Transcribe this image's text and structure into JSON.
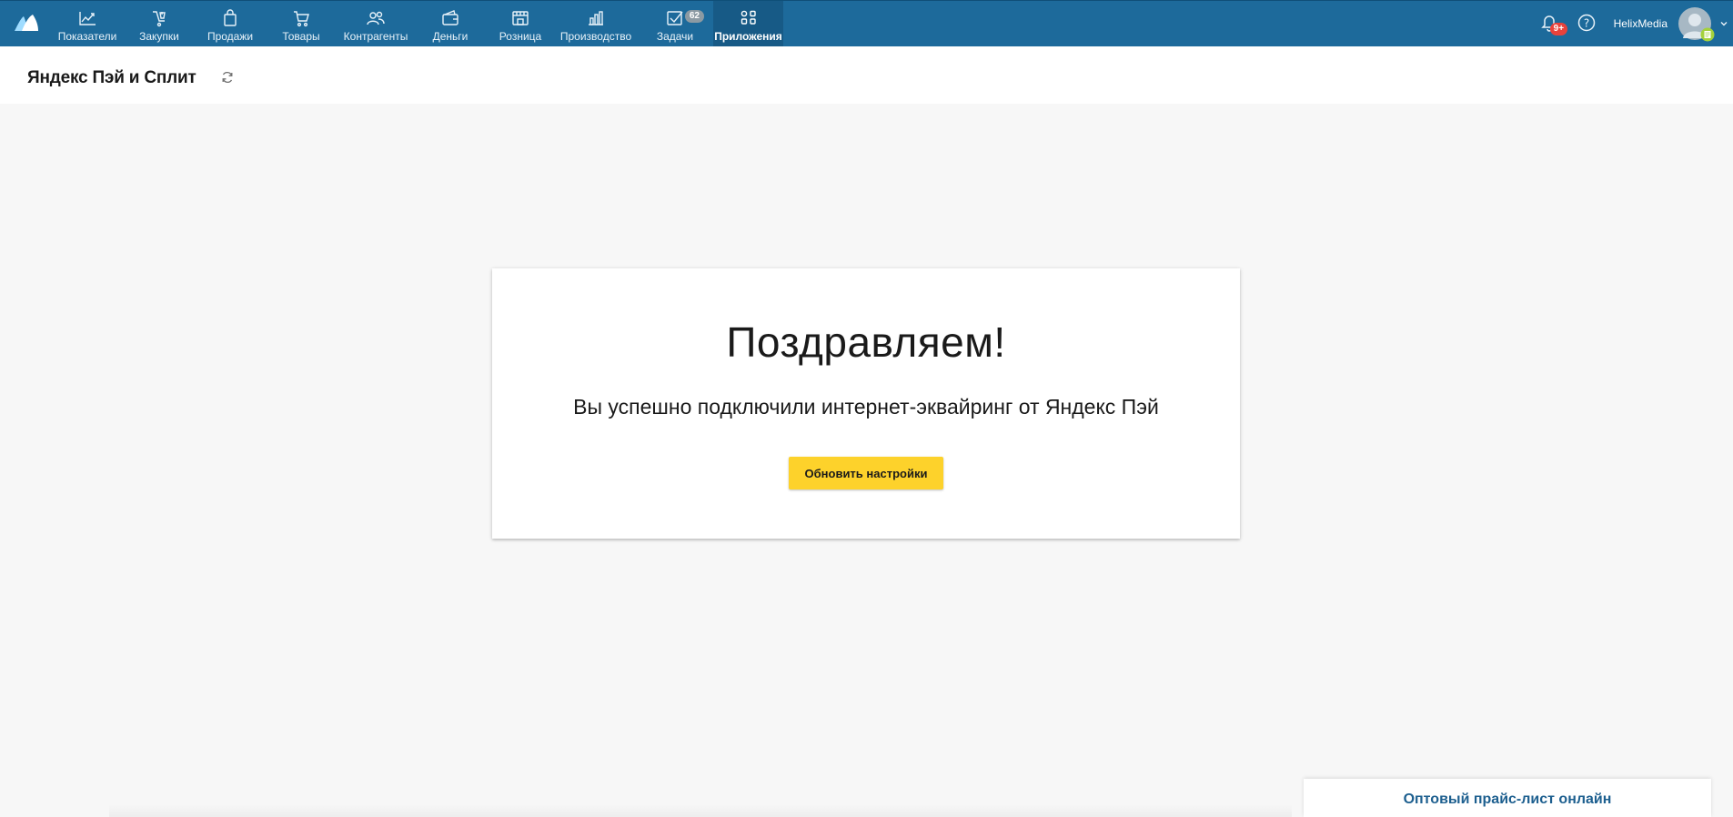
{
  "topnav": {
    "items": [
      {
        "label": "Показатели",
        "icon": "chart-line-icon"
      },
      {
        "label": "Закупки",
        "icon": "cart-purchase-icon"
      },
      {
        "label": "Продажи",
        "icon": "shopping-bag-icon"
      },
      {
        "label": "Товары",
        "icon": "shopping-cart-icon"
      },
      {
        "label": "Контрагенты",
        "icon": "users-icon"
      },
      {
        "label": "Деньги",
        "icon": "wallet-icon"
      },
      {
        "label": "Розница",
        "icon": "store-icon"
      },
      {
        "label": "Производство",
        "icon": "bar-chart-icon"
      },
      {
        "label": "Задачи",
        "icon": "checkbox-icon",
        "badge": "62"
      },
      {
        "label": "Приложения",
        "icon": "apps-grid-icon",
        "active": true
      }
    ]
  },
  "header_right": {
    "notifications_badge": "9+",
    "user_name": "HelixMedia"
  },
  "page": {
    "title": "Яндекс Пэй и Сплит"
  },
  "card": {
    "title": "Поздравляем!",
    "subtitle": "Вы успешно подключили интернет-эквайринг от Яндекс Пэй",
    "button_label": "Обновить настройки"
  },
  "pricelist": {
    "title": "Оптовый прайс-лист онлайн"
  },
  "colors": {
    "topbar": "#1d6a9b",
    "topbar_active": "#175a86",
    "button": "#fdd22b",
    "badge_red": "#e8423b",
    "link_blue": "#1d5f8f"
  }
}
